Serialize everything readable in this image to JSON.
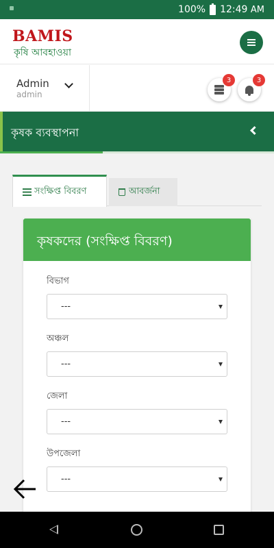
{
  "status_bar": {
    "battery": "100%",
    "time": "12:49",
    "ampm": "AM"
  },
  "app": {
    "logo": "BAMIS",
    "subtitle": "কৃষি আবহাওয়া",
    "menu_icon": "hamburger-icon"
  },
  "user": {
    "name": "Admin",
    "role": "admin",
    "chevron_icon": "chevron-down-icon"
  },
  "actions": {
    "server_badge": "3",
    "bell_badge": "3",
    "server_icon": "server-icon",
    "bell_icon": "bell-icon"
  },
  "section": {
    "title": "কৃষক ব্যবস্থাপনা",
    "back_icon": "chevron-left-icon",
    "progress_fraction": 0.375
  },
  "tabs": [
    {
      "label": "সংক্ষিপ্ত বিবরণ",
      "icon": "list-icon",
      "active": true
    },
    {
      "label": "আবর্জনা",
      "icon": "trash-icon",
      "active": false
    }
  ],
  "card": {
    "title": "কৃষকদের (সংক্ষিপ্ত বিবরণ)"
  },
  "fields": [
    {
      "label": "বিভাগ",
      "value": "---"
    },
    {
      "label": "অঞ্চল",
      "value": "---"
    },
    {
      "label": "জেলা",
      "value": "---"
    },
    {
      "label": "উপজেলা",
      "value": "---"
    }
  ],
  "colors": {
    "primary": "#1b6e45",
    "accent": "#4caf50",
    "logo_red": "#c0161b",
    "badge": "#e53935"
  },
  "nav": {
    "back_icon": "back-triangle-icon",
    "home_icon": "home-circle-icon",
    "recent_icon": "recents-square-icon"
  }
}
